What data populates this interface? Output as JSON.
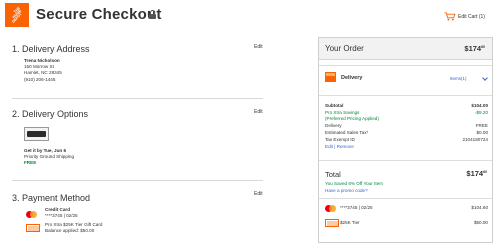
{
  "header": {
    "logo_text": [
      "THE",
      "HOME",
      "DEPOT"
    ],
    "title": "Secure Checkout",
    "edit_cart": "Edit Cart (1)"
  },
  "delivery_address": {
    "heading": "1. Delivery Address",
    "edit": "Edit",
    "name": "Trena Nicholson",
    "street": "150 Morrow St",
    "city": "Hamlet, NC 28345",
    "phone": "(910) 206-1445"
  },
  "delivery_options": {
    "heading": "2. Delivery Options",
    "edit": "Edit",
    "arrival": "Get it by Tue, Jun 6",
    "method": "Priority Ground Shipping",
    "price": "FREE"
  },
  "payment": {
    "heading": "3. Payment Method",
    "edit": "Edit",
    "card_title": "Credit Card",
    "card_detail": "****3745  |  02/25",
    "gift_title": "Pro Xtra $25K Tier Gift Card",
    "gift_detail": "Balance applied: $50.00"
  },
  "order": {
    "heading": "Your Order",
    "total_dollars": "$174",
    "total_cents": "60",
    "delivery_label": "Delivery",
    "items_label": "Items(1)",
    "summary": [
      {
        "key": "Subtotal",
        "value": "$104.00",
        "bold": true,
        "green": false
      },
      {
        "key": "Pro Xtra Savings",
        "value": "-$9.20",
        "bold": false,
        "green": true
      },
      {
        "key": "(Preferred Pricing Applied)",
        "value": "",
        "bold": false,
        "green": true
      },
      {
        "key": "Delivery",
        "value": "FREE",
        "bold": false,
        "green": false
      },
      {
        "key": "Estimated Sales Tax*",
        "value": "$0.00",
        "bold": false,
        "green": false
      },
      {
        "key": "Tax Exempt ID",
        "value": "2104180724",
        "bold": false,
        "green": false
      }
    ],
    "edit_remove": "Edit | Remove",
    "total_label": "Total",
    "saved_text": "You Saved 6% Off Your Item",
    "promo_text": "Have a promo code?",
    "pay_card": "****3745  |  02/25",
    "pay_card_amount": "$104.60",
    "pay_gift": "$25K Tier",
    "pay_gift_amount": "$50.00"
  }
}
